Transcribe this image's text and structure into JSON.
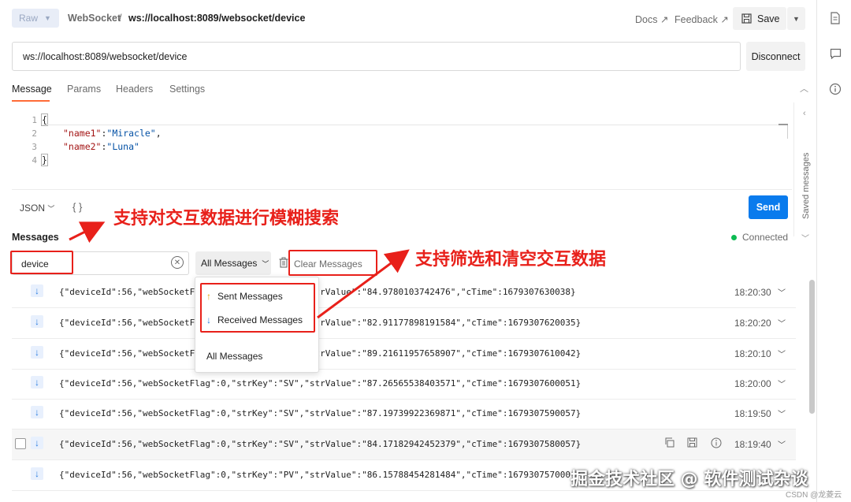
{
  "header": {
    "method": "Raw",
    "crumb_type": "WebSocket",
    "crumb_sep": "/",
    "crumb_url": "ws://localhost:8089/websocket/device",
    "docs_label": "Docs ↗",
    "feedback_label": "Feedback ↗",
    "save_label": "Save"
  },
  "url_bar": {
    "value": "ws://localhost:8089/websocket/device",
    "disconnect_label": "Disconnect"
  },
  "tabs": [
    {
      "label": "Message",
      "active": true
    },
    {
      "label": "Params",
      "active": false
    },
    {
      "label": "Headers",
      "active": false
    },
    {
      "label": "Settings",
      "active": false
    }
  ],
  "editor": {
    "lines": [
      "1",
      "2",
      "3",
      "4"
    ],
    "open_brace": "{",
    "close_brace": "}",
    "key1": "\"name1\"",
    "val1": "\"Miracle\"",
    "key2": "\"name2\"",
    "val2": "\"Luna\""
  },
  "composer": {
    "format": "JSON",
    "beautify": "{ }",
    "send_label": "Send",
    "saved_messages": "Saved messages"
  },
  "messages": {
    "title": "Messages",
    "status": "Connected",
    "search_value": "device",
    "filter_label": "All Messages",
    "clear_label": "Clear Messages",
    "rows": [
      {
        "text": "{\"deviceId\":56,\"webSocketFlag\":0,\"strKey\":\"SV\",\"strValue\":\"84.9780103742476\",\"cTime\":1679307630038}",
        "time": "18:20:30"
      },
      {
        "text": "{\"deviceId\":56,\"webSocketFlag\":0,\"strKey\":\"SV\",\"strValue\":\"82.91177898191584\",\"cTime\":1679307620035}",
        "time": "18:20:20"
      },
      {
        "text": "{\"deviceId\":56,\"webSocketFlag\":0,\"strKey\":\"SV\",\"strValue\":\"89.21611957658907\",\"cTime\":1679307610042}",
        "time": "18:20:10"
      },
      {
        "text": "{\"deviceId\":56,\"webSocketFlag\":0,\"strKey\":\"SV\",\"strValue\":\"87.26565538403571\",\"cTime\":1679307600051}",
        "time": "18:20:00"
      },
      {
        "text": "{\"deviceId\":56,\"webSocketFlag\":0,\"strKey\":\"SV\",\"strValue\":\"87.19739922369871\",\"cTime\":1679307590057}",
        "time": "18:19:50"
      },
      {
        "text": "{\"deviceId\":56,\"webSocketFlag\":0,\"strKey\":\"SV\",\"strValue\":\"84.17182942452379\",\"cTime\":1679307580057}",
        "time": "18:19:40"
      },
      {
        "text": "{\"deviceId\":56,\"webSocketFlag\":0,\"strKey\":\"PV\",\"strValue\":\"86.15788454281484\",\"cTime\":167930757000",
        "time": ""
      }
    ]
  },
  "menu": {
    "sent": "Sent Messages",
    "received": "Received Messages",
    "all": "All Messages"
  },
  "annotations": {
    "search_note": "支持对交互数据进行模糊搜索",
    "filter_note": "支持筛选和清空交互数据"
  },
  "watermark": "掘金技术社区 @ 软件测试杂谈",
  "csdn": "CSDN @龙菱云",
  "colors": {
    "accent": "#ff6c37",
    "send": "#097bed",
    "connected": "#0cbb52",
    "annotation": "#e8201a"
  }
}
